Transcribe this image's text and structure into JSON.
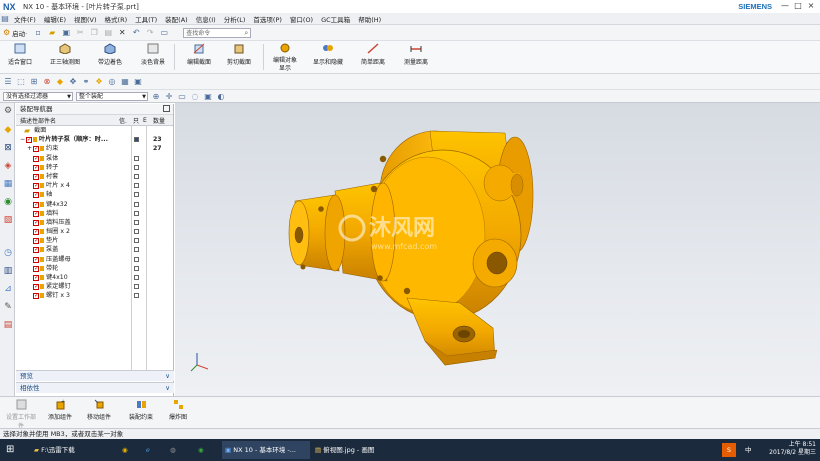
{
  "window": {
    "logo": "NX",
    "title": "NX 10 - 基本环境 - [叶片转子泵.prt]",
    "brand": "SIEMENS",
    "controls": [
      "—",
      "□",
      "×"
    ]
  },
  "menu": [
    "文件(F)",
    "编辑(E)",
    "视图(V)",
    "格式(R)",
    "工具(T)",
    "装配(A)",
    "信息(I)",
    "分析(L)",
    "首选项(P)",
    "窗口(O)",
    "GC工具箱",
    "帮助(H)"
  ],
  "quick_access": {
    "start_label": "启动·",
    "search_placeholder": "查找命令"
  },
  "ribbon": [
    "适合窗口",
    "正三轴测图",
    "带边着色",
    "淡色背景",
    "编辑截面",
    "剪切截面",
    "编辑对象显示",
    "显示和隐藏",
    "简单距离",
    "测量距离"
  ],
  "filter": {
    "selection_filter": "没有选择过滤器",
    "assembly": "整个装配"
  },
  "navigator": {
    "title": "装配导航器",
    "columns": {
      "name": "描述性部件名",
      "info": "信.",
      "r": "只",
      "e": "E",
      "count": "数量"
    },
    "rows": [
      {
        "name": "截面",
        "level": 0,
        "count": ""
      },
      {
        "name": "叶片转子泵（顺序：时...",
        "level": 0,
        "count": "23",
        "bold": true
      },
      {
        "name": "约束",
        "level": 1,
        "count": "27"
      },
      {
        "name": "泵体",
        "level": 1,
        "count": ""
      },
      {
        "name": "转子",
        "level": 1,
        "count": ""
      },
      {
        "name": "衬套",
        "level": 1,
        "count": ""
      },
      {
        "name": "叶片 x 4",
        "level": 1,
        "count": ""
      },
      {
        "name": "轴",
        "level": 1,
        "count": ""
      },
      {
        "name": "键4x32",
        "level": 1,
        "count": ""
      },
      {
        "name": "填料",
        "level": 1,
        "count": ""
      },
      {
        "name": "填料压盖",
        "level": 1,
        "count": ""
      },
      {
        "name": "挡圈 x 2",
        "level": 1,
        "count": ""
      },
      {
        "name": "垫片",
        "level": 1,
        "count": ""
      },
      {
        "name": "泵盖",
        "level": 1,
        "count": ""
      },
      {
        "name": "压盖螺母",
        "level": 1,
        "count": ""
      },
      {
        "name": "带轮",
        "level": 1,
        "count": ""
      },
      {
        "name": "键4x10",
        "level": 1,
        "count": ""
      },
      {
        "name": "紧定螺钉",
        "level": 1,
        "count": ""
      },
      {
        "name": "螺钉 x 3",
        "level": 1,
        "count": ""
      }
    ],
    "preview_label": "预览",
    "depend_label": "相依性"
  },
  "bottom_toolbar": [
    "设置工作部件",
    "添加组件",
    "移动组件",
    "装配约束",
    "爆炸图"
  ],
  "status": "选择对象并使用 MB3，或者双击某一对象",
  "watermark": {
    "name": "沐风网",
    "url": "www.mfcad.com"
  },
  "taskbar": {
    "items": [
      "F:\\迅雷下载",
      "NX 10 - 基本环境 -...",
      "俯视图.jpg - 画图"
    ],
    "time": "上午 8:51",
    "date": "2017/8/2 星期三",
    "ime": "中"
  },
  "colors": {
    "part": "#f2a800",
    "part_dark": "#b87400",
    "accent": "#1d5fa8"
  }
}
